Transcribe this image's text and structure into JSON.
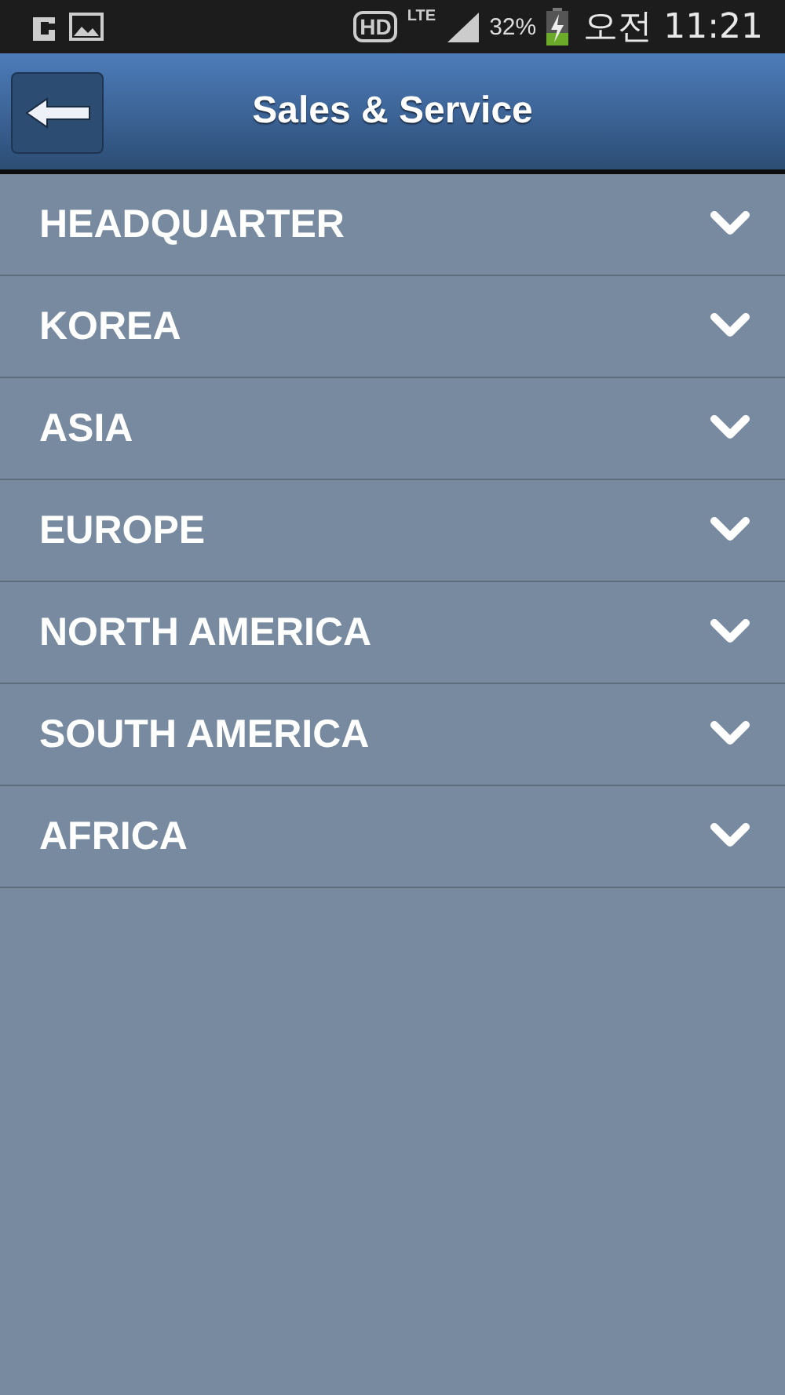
{
  "status_bar": {
    "hd": "HD",
    "network": "LTE",
    "battery": "32%",
    "charging": true,
    "time": "오전 11:21"
  },
  "header": {
    "title": "Sales & Service"
  },
  "regions": [
    {
      "label": "HEADQUARTER",
      "expanded": false
    },
    {
      "label": "KOREA",
      "expanded": false
    },
    {
      "label": "ASIA",
      "expanded": false
    },
    {
      "label": "EUROPE",
      "expanded": false
    },
    {
      "label": "NORTH AMERICA",
      "expanded": false
    },
    {
      "label": "SOUTH AMERICA",
      "expanded": false
    },
    {
      "label": "AFRICA",
      "expanded": false
    }
  ]
}
